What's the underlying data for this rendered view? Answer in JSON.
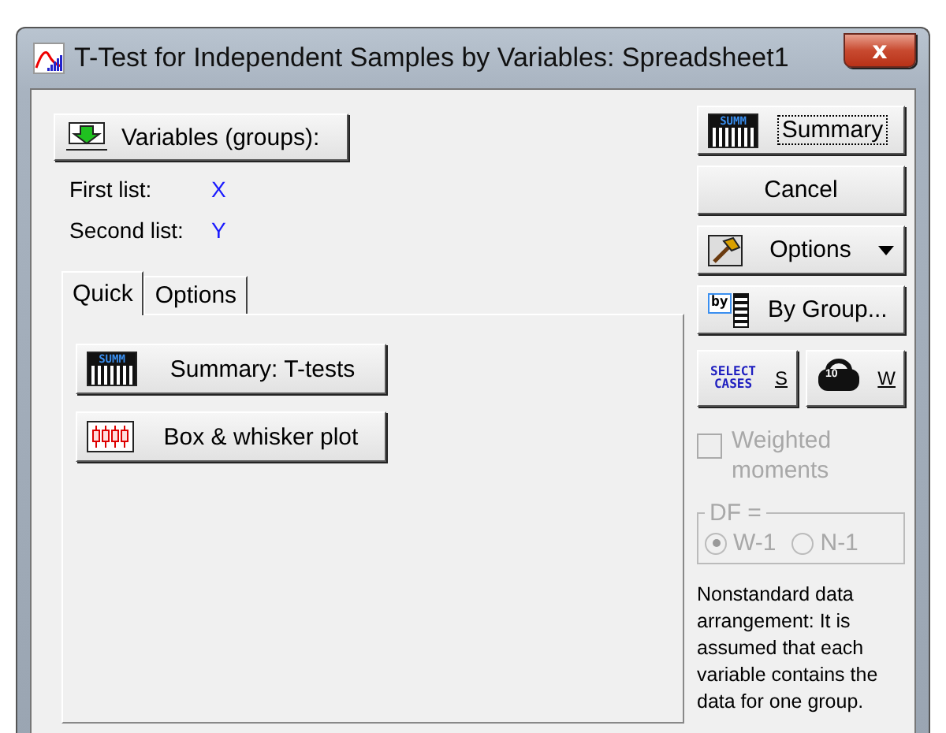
{
  "window": {
    "title": "T-Test for Independent Samples by Variables: Spreadsheet1",
    "close": "x"
  },
  "variables_button": {
    "label": "Variables (groups):"
  },
  "lists": [
    {
      "label": "First list:",
      "value": "X"
    },
    {
      "label": "Second list:",
      "value": "Y"
    }
  ],
  "tabs": [
    {
      "label": "Quick",
      "selected": true
    },
    {
      "label": "Options",
      "selected": false
    }
  ],
  "quick_buttons": [
    {
      "label": "Summary: T-tests",
      "icon_text": "SUMM",
      "kind": "summary"
    },
    {
      "label": "Box & whisker plot",
      "kind": "boxplot"
    }
  ],
  "side_buttons": [
    {
      "label": "Summary",
      "icon_text": "SUMM",
      "kind": "summary",
      "focused": true
    },
    {
      "label": "Cancel",
      "kind": "plain",
      "focused": false
    },
    {
      "label": "Options",
      "kind": "options",
      "focused": false
    },
    {
      "label": "By Group...",
      "icon_text": "by",
      "kind": "bygroup",
      "focused": false
    }
  ],
  "select_cases": {
    "icon_text": "SELECT CASES",
    "label": "S"
  },
  "weight": {
    "icon_text": "10",
    "label": "W"
  },
  "weighted_moments": {
    "label": "Weighted moments",
    "checked": false,
    "disabled": true
  },
  "df": {
    "title": "DF =",
    "options": [
      {
        "label": "W-1",
        "selected": true
      },
      {
        "label": "N-1",
        "selected": false
      }
    ],
    "disabled": true
  },
  "note": "Nonstandard data arrangement: It is assumed that each variable contains the data for one group."
}
